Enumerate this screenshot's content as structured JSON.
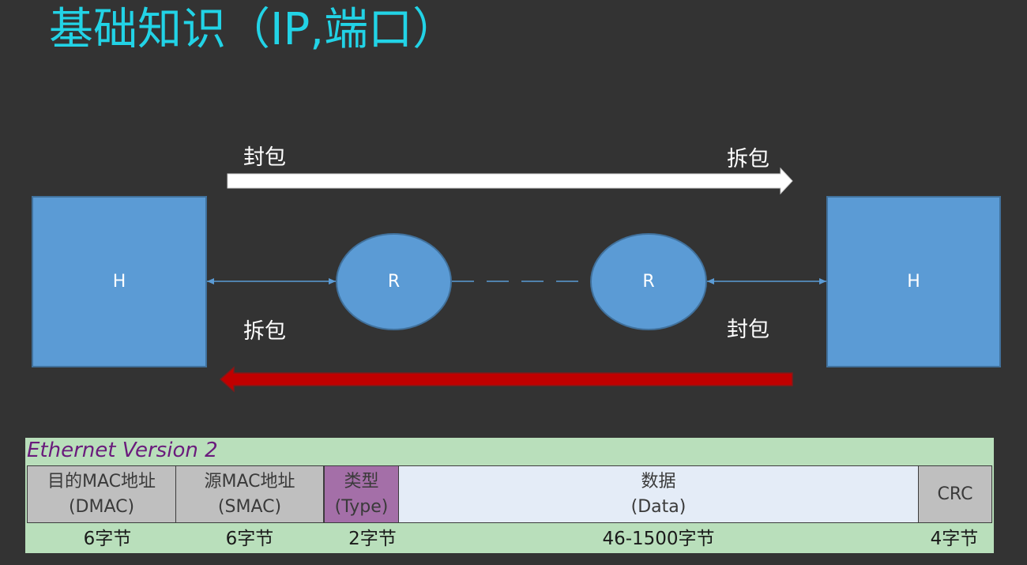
{
  "title": "基础知识（IP,端口）",
  "labels": {
    "top_left": "封包",
    "top_right": "拆包",
    "bottom_left": "拆包",
    "bottom_right": "封包"
  },
  "nodes": {
    "host_left": "H",
    "router_left": "R",
    "router_right": "R",
    "host_right": "H"
  },
  "colors": {
    "title": "#22d3e6",
    "box_fill": "#5b9bd5",
    "forward_arrow": "#ffffff",
    "return_arrow": "#c00000",
    "frame_bg": "#b9dfbb",
    "type_field": "#a46fa8"
  },
  "ethernet": {
    "title": "Ethernet Version 2",
    "fields": [
      {
        "line1": "目的MAC地址",
        "line2": "(DMAC)",
        "size": "6字节"
      },
      {
        "line1": "源MAC地址",
        "line2": "(SMAC)",
        "size": "6字节"
      },
      {
        "line1": "类型",
        "line2": "(Type)",
        "size": "2字节"
      },
      {
        "line1": "数据",
        "line2": "(Data)",
        "size": "46-1500字节"
      },
      {
        "line1": "CRC",
        "line2": "",
        "size": "4字节"
      }
    ]
  }
}
